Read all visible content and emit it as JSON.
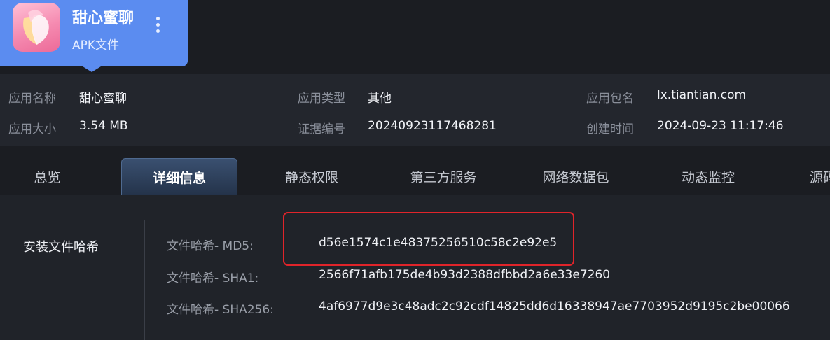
{
  "app": {
    "name": "甜心蜜聊",
    "file_type": "APK文件"
  },
  "info": {
    "app_name_label": "应用名称",
    "app_name_value": "甜心蜜聊",
    "app_type_label": "应用类型",
    "app_type_value": "其他",
    "package_label": "应用包名",
    "package_value": "lx.tiantian.com",
    "size_label": "应用大小",
    "size_value": "3.54 MB",
    "evidence_label": "证据编号",
    "evidence_value": "20240923117468281",
    "created_label": "创建时间",
    "created_value": "2024-09-23 11:17:46"
  },
  "tabs": [
    {
      "label": "总览"
    },
    {
      "label": "详细信息"
    },
    {
      "label": "静态权限"
    },
    {
      "label": "第三方服务"
    },
    {
      "label": "网络数据包"
    },
    {
      "label": "动态监控"
    },
    {
      "label": "源码"
    }
  ],
  "hashes": {
    "section_title": "安装文件哈希",
    "rows": [
      {
        "label": "文件哈希- MD5:",
        "value": "d56e1574c1e48375256510c58c2e92e5"
      },
      {
        "label": "文件哈希- SHA1:",
        "value": "2566f71afb175de4b93d2388dfbbd2a6e33e7260"
      },
      {
        "label": "文件哈希- SHA256:",
        "value": "4af6977d9e3c48adc2c92cdf14825dd6d16338947ae7703952d9195c2be00066"
      }
    ]
  },
  "colors": {
    "accent_blue": "#5b8cf0",
    "highlight_red": "#e0242a",
    "background": "#1b1d22"
  }
}
